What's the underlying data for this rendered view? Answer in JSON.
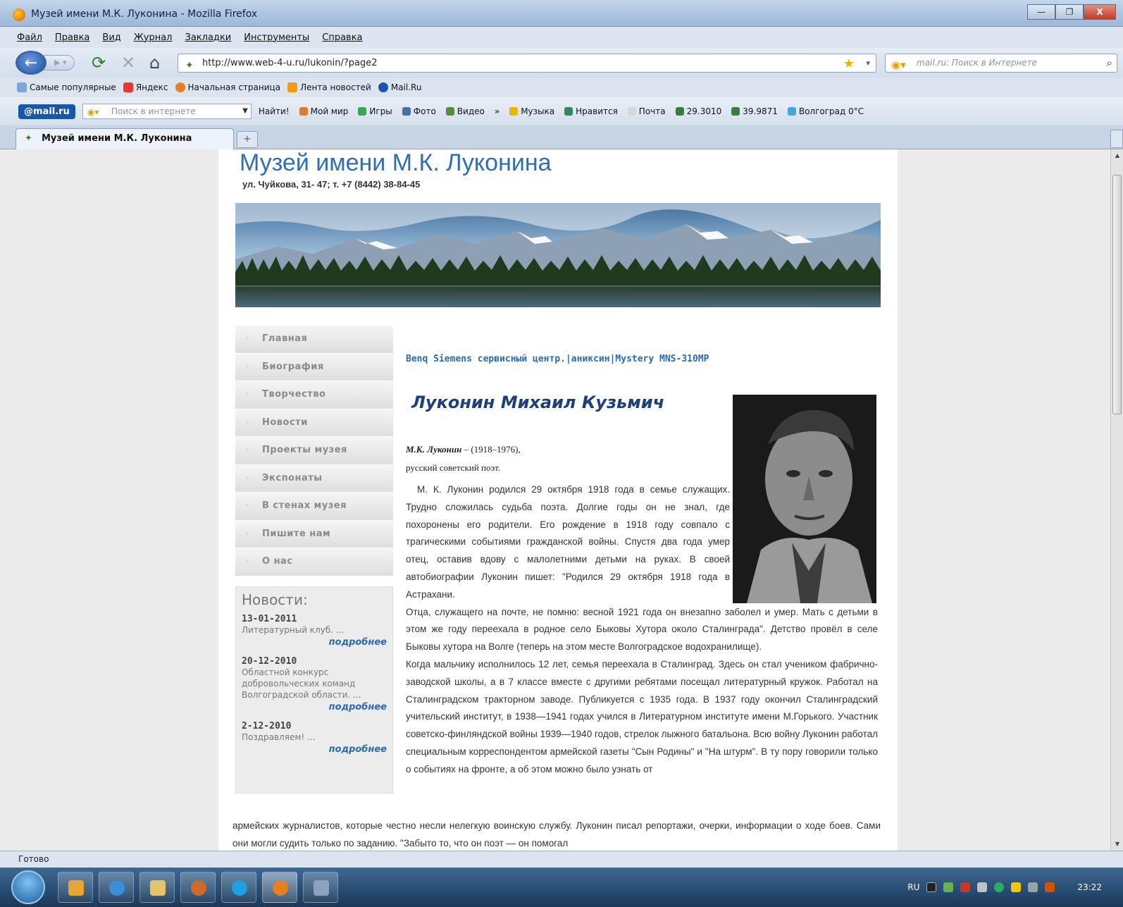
{
  "window": {
    "title": "Музей имени М.К. Луконина - Mozilla Firefox",
    "minimize": "—",
    "maximize": "❐",
    "close": "X"
  },
  "menu": [
    "Файл",
    "Правка",
    "Вид",
    "Журнал",
    "Закладки",
    "Инструменты",
    "Справка"
  ],
  "navigation": {
    "url": "http://www.web-4-u.ru/lukonin/?page2",
    "search_placeholder": "mail.ru: Поиск в Интернете"
  },
  "bookmarks": [
    "Самые популярные",
    "Яндекс",
    "Начальная страница",
    "Лента новостей",
    "Mail.Ru"
  ],
  "mail_toolbar": {
    "logo": "@mail.ru",
    "search_placeholder": "Поиск в интернете",
    "find_label": "Найти!",
    "items": [
      "Мой мир",
      "Игры",
      "Фото",
      "Видео",
      "»",
      "Музыка",
      "Нравится",
      "Почта",
      "29.3010",
      "39.9871",
      "Волгоград 0°C"
    ]
  },
  "tab": {
    "label": "Музей имени М.К. Луконина",
    "new_tab": "+"
  },
  "site": {
    "title": "Музей имени М.К. Луконина",
    "address": "ул. Чуйкова, 31- 47; т. +7 (8442) 38-84-45"
  },
  "sidebar_menu": [
    "Главная",
    "Биография",
    "Творчество",
    "Новости",
    "Проекты музея",
    "Экспонаты",
    "В стенах музея",
    "Пишите нам",
    "О нас"
  ],
  "news": {
    "title": "Новости:",
    "items": [
      {
        "date": "13-01-2011",
        "text": "Литературный клуб. ...",
        "more": "подробнее"
      },
      {
        "date": "20-12-2010",
        "text": "Областной конкурс добровольческих команд Волгоградской области. ...",
        "more": "подробнее"
      },
      {
        "date": "2-12-2010",
        "text": "Поздравляем! ...",
        "more": "подробнее"
      }
    ]
  },
  "content": {
    "ad_links": "Benq Siemens сервисный центр.|аниксин|Mystery MNS-310MP",
    "name": "Луконин Михаил Кузьмич",
    "caption_name": "М.К. Луконин",
    "caption_years": " – (1918–1976),",
    "caption_role": "русский советский поэт.",
    "para1": "М. К. Луконин родился 29 октября 1918 года в семье служащих. Трудно сложилась судьба поэта. Долгие годы он не знал, где похоронены его родители. Его рождение в 1918 году совпало с трагическими событиями гражданской войны. Спустя два года умер отец, оставив вдову с малолетними детьми на руках. В своей автобиографии Луконин пишет: \"Родился 29 октября 1918 года в Астрахани.",
    "para2": "Отца, служащего на почте, не помню: весной 1921 года он внезапно заболел и умер. Мать с детьми в этом же году переехала в родное село Быковы Хутора около Сталинграда\". Детство провёл в селе Быковы хутора на Волге (теперь на этом месте Волгоградское водохранилище).",
    "para3": "Когда мальчику исполнилось 12 лет, семья переехала в Сталинград. Здесь он стал учеником фабрично-заводской школы, а в 7 классе вместе с другими ребятами посещал литературный кружок. Работал на Сталинградском тракторном заводе. Публикуется с 1935 года. В 1937 году окончил Сталинградский учительский институт, в 1938—1941 годах учился в Литературном институте имени М.Горького. Участник советско-финляндской войны 1939—1940 годов, стрелок лыжного батальона. Всю войну Луконин работал специальным корреспондентом армейской газеты \"Сын Родины\" и \"На штурм\". В ту пору говорили только о событиях на фронте, а об этом можно было узнать от",
    "para4": "армейских журналистов, которые честно несли нелегкую воинскую службу. Луконин писал репортажи, очерки, информации о ходе боев. Сами они могли судить только по заданию. \"Забыто то, что он поэт — он помогал"
  },
  "status": "Готово",
  "taskbar": {
    "lang": "RU",
    "time": "23:22"
  }
}
